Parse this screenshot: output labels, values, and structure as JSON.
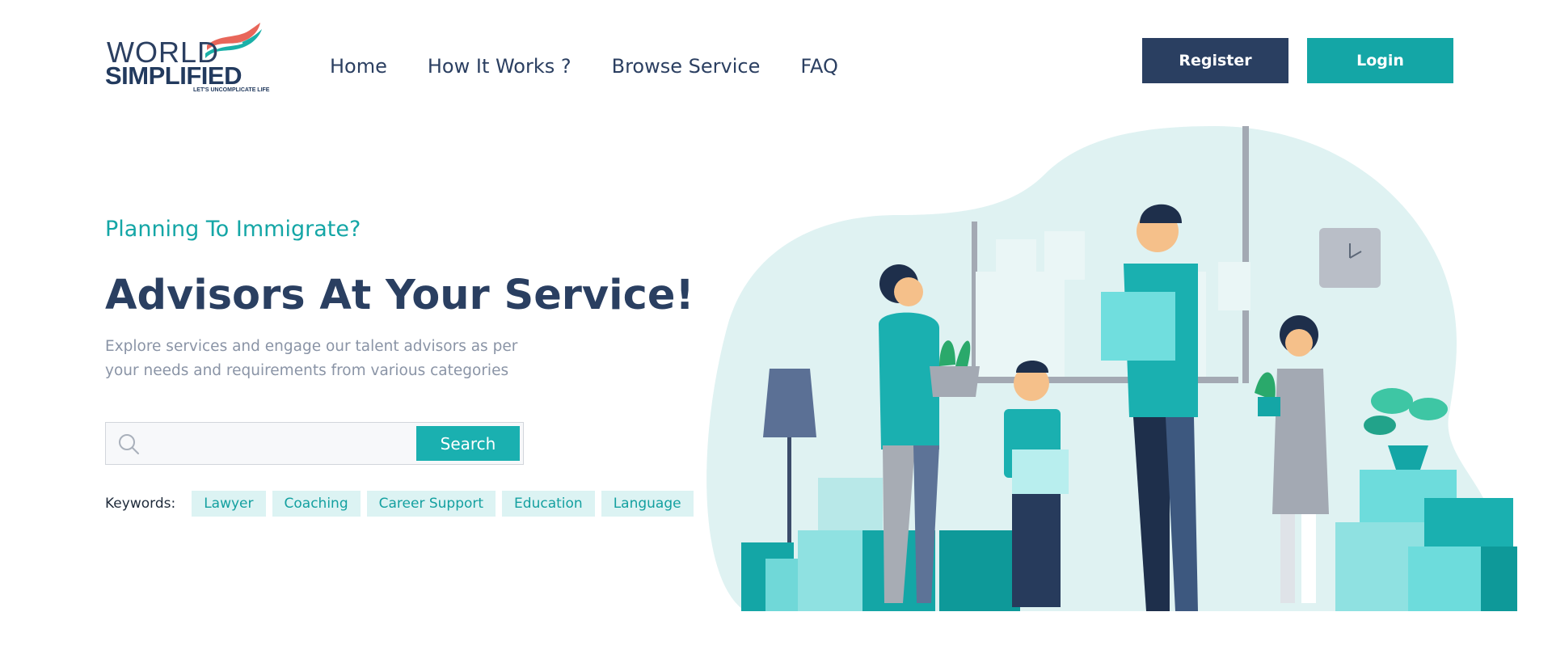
{
  "logo": {
    "line1": "WORLD",
    "line2": "SIMPLIFIED",
    "tagline": "LET'S UNCOMPLICATE LIFE"
  },
  "nav": {
    "items": [
      {
        "label": "Home"
      },
      {
        "label": "How It Works ?"
      },
      {
        "label": "Browse Service"
      },
      {
        "label": "FAQ"
      }
    ]
  },
  "auth": {
    "register_label": "Register",
    "login_label": "Login"
  },
  "hero": {
    "eyebrow": "Planning To Immigrate?",
    "headline": "Advisors At Your Service!",
    "subtext": "Explore services and engage our talent advisors as per your needs and requirements from various categories"
  },
  "search": {
    "placeholder": "",
    "value": "",
    "button_label": "Search"
  },
  "keywords": {
    "label": "Keywords:",
    "items": [
      "Lawyer",
      "Coaching",
      "Career Support",
      "Education",
      "Language"
    ]
  },
  "colors": {
    "navy": "#2a3f61",
    "teal": "#14a6a6",
    "teal_light": "#dcf3f3",
    "muted": "#8a94a6"
  },
  "icons": {
    "search": "search-icon",
    "logo_flag": "flag-icon"
  }
}
